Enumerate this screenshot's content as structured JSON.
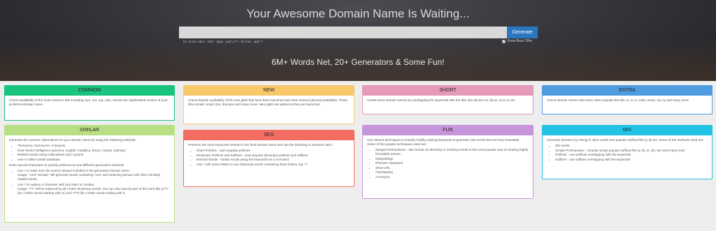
{
  "hero": {
    "title": "Your Awesome Domain Name Is Waiting...",
    "search_placeholder": "",
    "generate_label": "Generate",
    "examples": "try: music video , best - apps , pay* p?? , let it be , app* ?",
    "best_offer_label": "Show Best Offer",
    "best_offer_checked": "✓",
    "tagline": "6M+ Words Net, 20+ Generators & Some Fun!"
  },
  "colors": {
    "common": "#19c47f",
    "new": "#f8c86a",
    "short": "#e59ab7",
    "extra": "#4f9be0",
    "similar": "#b9df84",
    "seo": "#f36d62",
    "fun": "#c795d9",
    "mix": "#22c3e3"
  },
  "cards": {
    "common": {
      "title": "COMMON",
      "text": "Check availability of the most common tlds including com, net, org. Also, checks the hyphenated version of your preferred domain name."
    },
    "new": {
      "title": "NEW",
      "text": "Check domain availability of the new gtlds that have been launched and have entered general availability. These tlds include: email, link, domains and many more. New gtlds are added as they are launched."
    },
    "short": {
      "title": "SHORT",
      "text": "Create short domain names by overlapping the keywords with the tlds, like del.icio.us, fly.us, ch.ic.ec etc."
    },
    "extra": {
      "title": "EXTRA",
      "text": "Check domain names with some other popular tlds like co, io, it, mobi, name, me, ly and many more."
    },
    "similar": {
      "title": "SIMILAR",
      "intro": "Generate the common alternatives for your domain name by using the following methods:",
      "methods": [
        "Thesaurus, Synonyms, Antonyms",
        "Real World Intelligence (america, english, metallica, ferrari, mozart, batman)",
        "Related words using collocations and n-grams",
        "over 6 million words database"
      ],
      "special_intro": "Enter special characters to specify preferences and different generation methods",
      "star_rule": "Use * to make sure the word is always included in the generated domain name.",
      "star_usage": "Usage: \"cool* domain\" will generate words containing 'cool' and replacing domain with other similarly related words.",
      "q_rule": "Use ? to replace a character with any letter or number.",
      "q_usage": "Usage: \"??\" will be replaced by all 2 letter dictionary words. You can also specify part of the word like p??? (for 4 letter words starting with 'p') and ???t (for 4 letter words ending with t)."
    },
    "seo": {
      "title": "SEO",
      "intro": "Preserve the main keywords entered in the final domain name and use the following to preserve SEO:",
      "items": [
        "Short Prefixes - uses popular prefixes",
        "Dictionary Prefixes and Suffixes - uses popular dictionary prefixes and suffixes",
        "Derived Words - similar words using the keywords as a root word",
        "Use * with some letters to use dictionary words containing those letters. Eg: \"r*"
      ]
    },
    "fun": {
      "title": "FUN",
      "intro": "Use various techniques to smartly modify existing keywords to generate new words that are very brandable. Some of the popular techniques used are:",
      "items": [
        "Merged Portmanteau - also known as blending or meshing words is the most popular way of creating highly brandable names.",
        "Misspellings",
        "Phonetic Variations",
        "Short URL",
        "Overlapping",
        "Acronyms"
      ]
    },
    "mix": {
      "title": "MIX",
      "intro": "Generate domains by mixing in other words and popular suffixes like ly, ify etc. Some of the methods used are:",
      "items": [
        "Mix words",
        "Simple Portmanteau - Smartly merge popular suffixes like ly, ify, er, ish, ism and many more",
        "Prefixes - use prefixes overlapping with the keywords",
        "Suffixes - use suffixes overlapping with the keywords"
      ]
    }
  }
}
